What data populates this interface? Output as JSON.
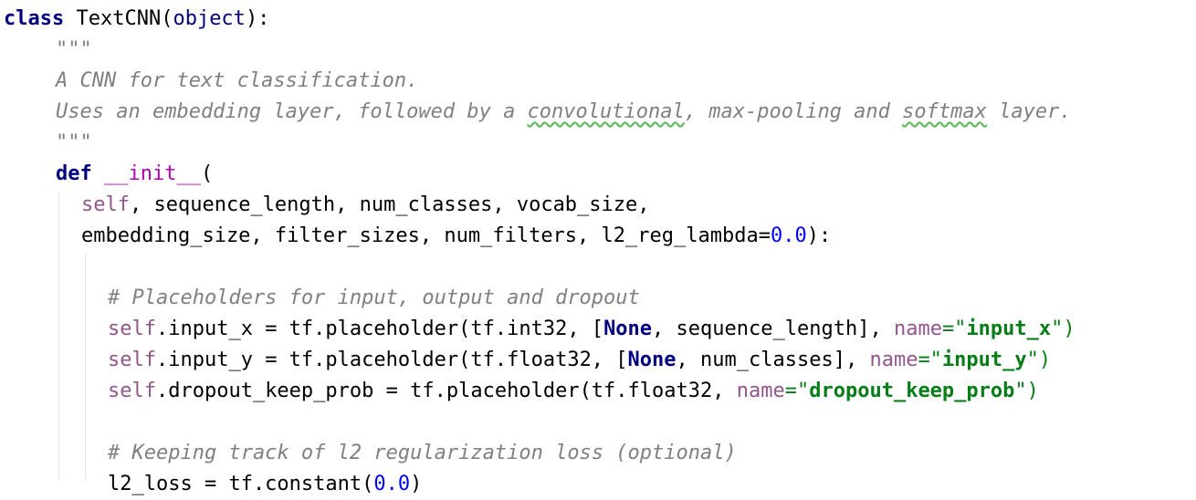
{
  "code": {
    "class_keyword": "class",
    "class_name": "TextCNN",
    "base_class": "object",
    "doc_open": "\"\"\"",
    "doc_line1": "A CNN for text classification.",
    "doc_line2_a": "Uses an embedding layer, followed by a ",
    "doc_line2_typo1": "convolutional",
    "doc_line2_b": ", max-pooling and ",
    "doc_line2_typo2": "softmax",
    "doc_line2_c": " layer.",
    "doc_close": "\"\"\"",
    "def_keyword": "def",
    "init_name": "__init__",
    "self_word": "self",
    "params_line1_rest": ", sequence_length, num_classes, vocab_size,",
    "params_line2_a": "embedding_size, filter_sizes, num_filters, l2_reg_lambda=",
    "params_line2_num": "0.0",
    "params_line2_b": "):",
    "comment1": "# Placeholders for input, output and dropout",
    "l1_a": ".input_x = tf.placeholder(tf.int32, [",
    "none": "None",
    "l1_b": ", sequence_length], ",
    "name_kw": "name",
    "eq_quote": "=\"",
    "l1_str": "input_x",
    "close_quote_paren": "\")",
    "l2_a": ".input_y = tf.placeholder(tf.float32, [",
    "l2_b": ", num_classes], ",
    "l2_str": "input_y",
    "l3_a": ".dropout_keep_prob = tf.placeholder(tf.float32, ",
    "l3_str": "dropout_keep_prob",
    "comment2": "# Keeping track of l2 regularization loss (optional)",
    "l4_a": "l2_loss = tf.constant(",
    "l4_num": "0.0",
    "l4_b": ")"
  },
  "colors": {
    "keyword": "#000080",
    "self": "#94558d",
    "string": "#067d17",
    "number": "#0000ff",
    "comment": "#808080",
    "magic": "#b200b2"
  }
}
